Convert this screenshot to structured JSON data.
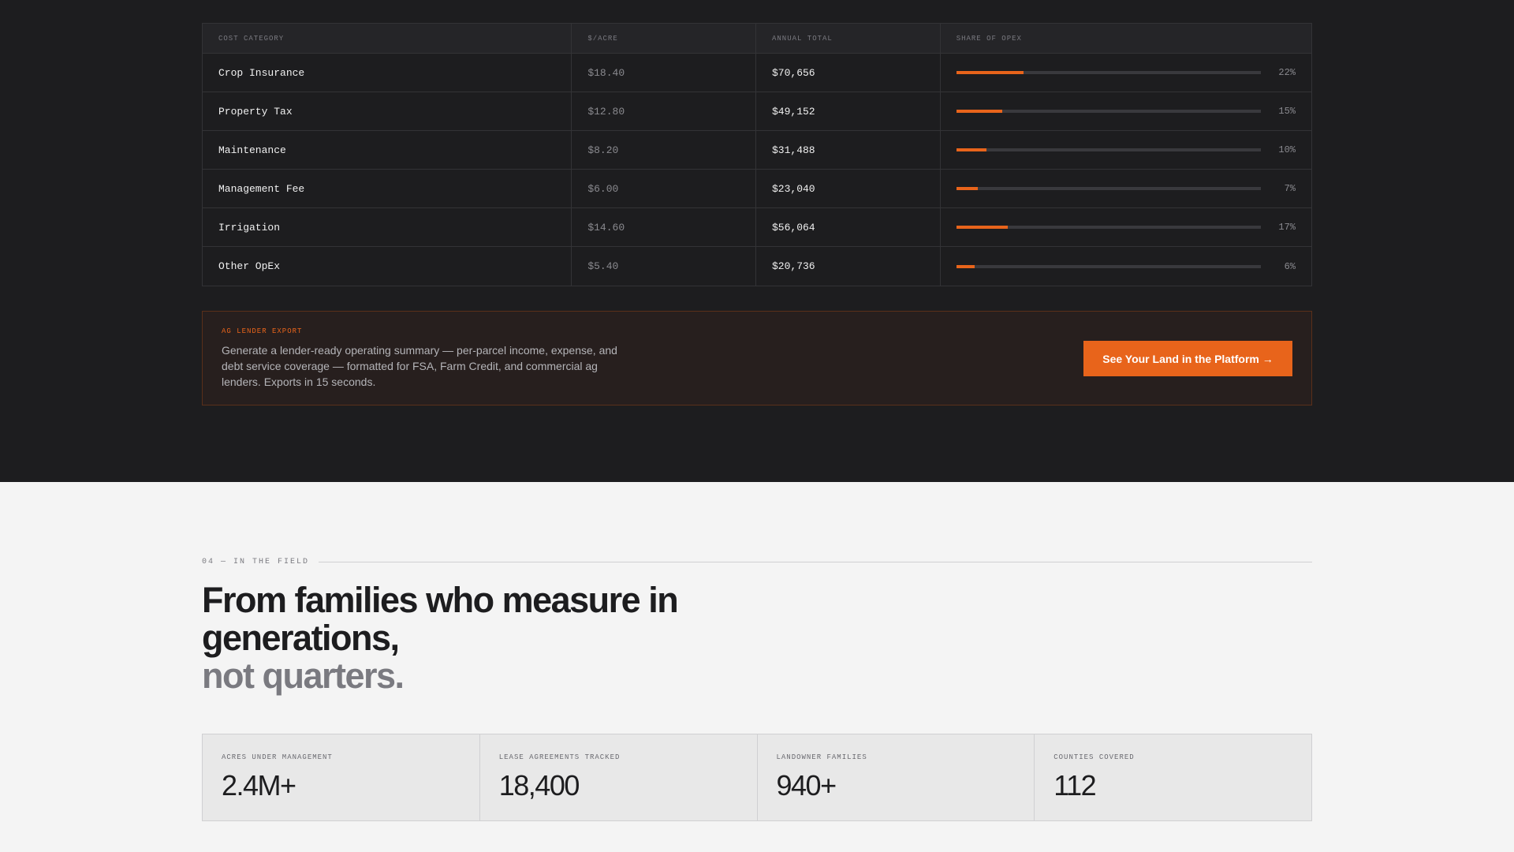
{
  "cost_table": {
    "headers": [
      "COST CATEGORY",
      "$/ACRE",
      "ANNUAL TOTAL",
      "SHARE OF OPEX"
    ],
    "rows": [
      {
        "category": "Crop Insurance",
        "per_acre": "$18.40",
        "annual_total": "$70,656",
        "share": "22%",
        "share_value": 22
      },
      {
        "category": "Property Tax",
        "per_acre": "$12.80",
        "annual_total": "$49,152",
        "share": "15%",
        "share_value": 15
      },
      {
        "category": "Maintenance",
        "per_acre": "$8.20",
        "annual_total": "$31,488",
        "share": "10%",
        "share_value": 10
      },
      {
        "category": "Management Fee",
        "per_acre": "$6.00",
        "annual_total": "$23,040",
        "share": "7%",
        "share_value": 7
      },
      {
        "category": "Irrigation",
        "per_acre": "$14.60",
        "annual_total": "$56,064",
        "share": "17%",
        "share_value": 17
      },
      {
        "category": "Other OpEx",
        "per_acre": "$5.40",
        "annual_total": "$20,736",
        "share": "6%",
        "share_value": 6
      }
    ]
  },
  "export": {
    "tag": "AG LENDER EXPORT",
    "text": "Generate a lender-ready operating summary — per-parcel income, expense, and debt service coverage — formatted for FSA, Farm Credit, and commercial ag lenders. Exports in 15 seconds.",
    "button_label": "See Your Land in the Platform →"
  },
  "field": {
    "eyebrow": "04 — IN THE FIELD",
    "headline": "From families who measure in generations,",
    "headline_muted": "not quarters."
  },
  "stats": [
    {
      "label": "ACRES UNDER MANAGEMENT",
      "value": "2.4M+"
    },
    {
      "label": "LEASE AGREEMENTS TRACKED",
      "value": "18,400"
    },
    {
      "label": "LANDOWNER FAMILIES",
      "value": "940+"
    },
    {
      "label": "COUNTIES COVERED",
      "value": "112"
    }
  ],
  "colors": {
    "accent": "#e8641b",
    "dark_bg": "#1d1d1f",
    "light_bg": "#f4f4f4"
  }
}
